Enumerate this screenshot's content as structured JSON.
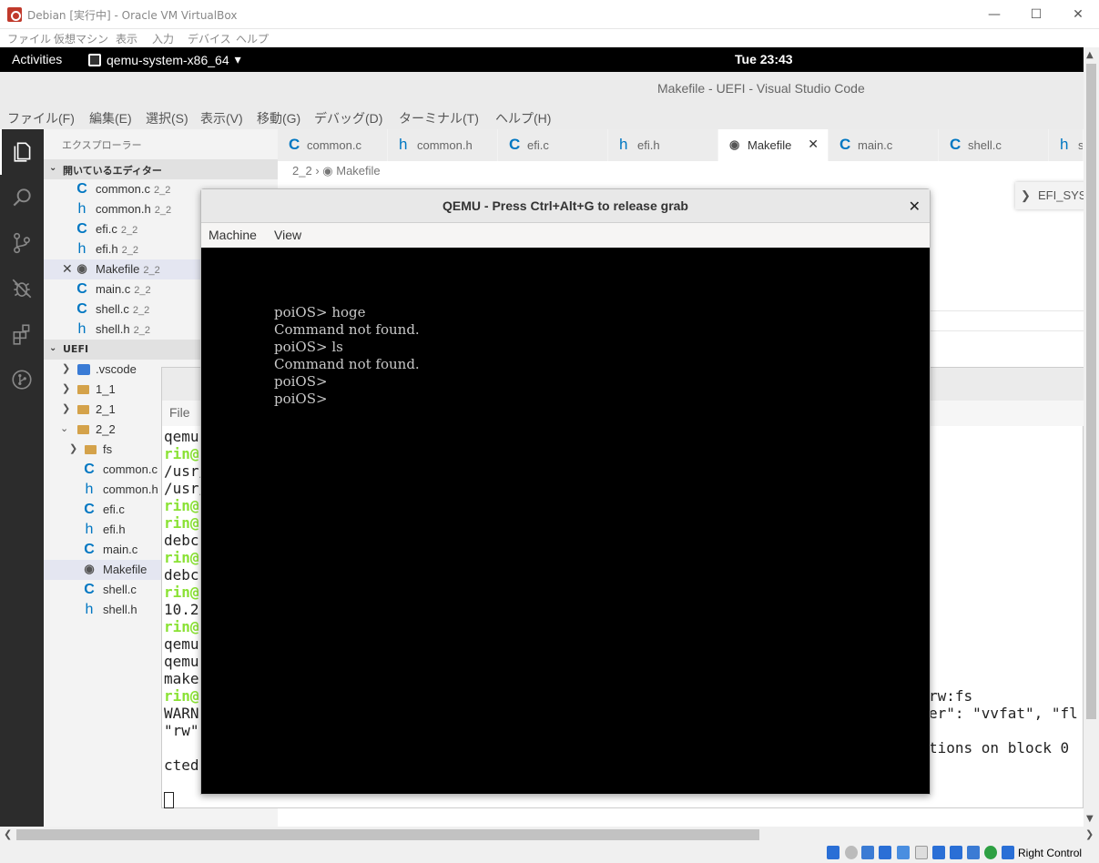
{
  "vbox": {
    "title": "Debian [実行中] - Oracle VM VirtualBox",
    "menu": [
      "ファイル",
      "仮想マシン",
      "表示",
      "入力",
      "デバイス",
      "ヘルプ"
    ],
    "host_key": "Right Control"
  },
  "gnome": {
    "activities": "Activities",
    "app": "qemu-system-x86_64",
    "clock": "Tue 23:43"
  },
  "vscode": {
    "title": "Makefile - UEFI - Visual Studio Code",
    "menu": [
      "ファイル(F)",
      "編集(E)",
      "選択(S)",
      "表示(V)",
      "移動(G)",
      "デバッグ(D)",
      "ターミナル(T)",
      "ヘルプ(H)"
    ],
    "explorer_title": "エクスプローラー",
    "open_editors_header": "開いているエディター",
    "open_editors": [
      {
        "name": "common.c",
        "tag": "2_2",
        "icon": "C"
      },
      {
        "name": "common.h",
        "tag": "2_2",
        "icon": "h"
      },
      {
        "name": "efi.c",
        "tag": "2_2",
        "icon": "C"
      },
      {
        "name": "efi.h",
        "tag": "2_2",
        "icon": "h"
      },
      {
        "name": "Makefile",
        "tag": "2_2",
        "icon": "make"
      },
      {
        "name": "main.c",
        "tag": "2_2",
        "icon": "C"
      },
      {
        "name": "shell.c",
        "tag": "2_2",
        "icon": "C"
      },
      {
        "name": "shell.h",
        "tag": "2_2",
        "icon": "h"
      }
    ],
    "workspace_header": "UEFI",
    "tree": [
      {
        "name": ".vscode",
        "kind": "folder-vscode"
      },
      {
        "name": "1_1",
        "kind": "folder"
      },
      {
        "name": "2_1",
        "kind": "folder"
      },
      {
        "name": "2_2",
        "kind": "folder-open"
      },
      {
        "name": "fs",
        "kind": "folder"
      },
      {
        "name": "common.c",
        "kind": "C"
      },
      {
        "name": "common.h",
        "kind": "h"
      },
      {
        "name": "efi.c",
        "kind": "C"
      },
      {
        "name": "efi.h",
        "kind": "h"
      },
      {
        "name": "main.c",
        "kind": "C"
      },
      {
        "name": "Makefile",
        "kind": "make"
      },
      {
        "name": "shell.c",
        "kind": "C"
      },
      {
        "name": "shell.h",
        "kind": "h"
      }
    ],
    "tabs": [
      {
        "label": "common.c",
        "icon": "C"
      },
      {
        "label": "common.h",
        "icon": "h"
      },
      {
        "label": "efi.c",
        "icon": "C"
      },
      {
        "label": "efi.h",
        "icon": "h"
      },
      {
        "label": "Makefile",
        "icon": "make"
      },
      {
        "label": "main.c",
        "icon": "C"
      },
      {
        "label": "shell.c",
        "icon": "C"
      },
      {
        "label": "sh",
        "icon": "h"
      }
    ],
    "breadcrumb_folder": "2_2",
    "breadcrumb_file": "Makefile",
    "outline_label": "EFI_SYS"
  },
  "terminal": {
    "menu_file": "File",
    "lines": [
      {
        "text": "qemu",
        "green": false
      },
      {
        "text": "rin@",
        "green": true
      },
      {
        "text": "/usr/",
        "green": false
      },
      {
        "text": "/usr/",
        "green": false
      },
      {
        "text": "rin@",
        "green": true
      },
      {
        "text": "rin@",
        "green": true
      },
      {
        "text": "debc",
        "green": false
      },
      {
        "text": "rin@",
        "green": true
      },
      {
        "text": "debc",
        "green": false
      },
      {
        "text": "rin@",
        "green": true
      },
      {
        "text": "10.2",
        "green": false
      },
      {
        "text": "rin@",
        "green": true
      },
      {
        "text": "qemu",
        "green": false
      },
      {
        "text": "qemu",
        "green": false
      },
      {
        "text": "make",
        "green": false
      },
      {
        "text": "rin@",
        "green": true
      },
      {
        "text": "WARN",
        "green": false
      },
      {
        "text": "\"rw\"",
        "green": false
      },
      {
        "text": "",
        "green": false
      },
      {
        "text": "cted",
        "green": false
      }
    ],
    "right_lines": [
      {
        "text": "rw:fs",
        "row": 15
      },
      {
        "text": "er\": \"vvfat\", \"fl",
        "row": 16
      },
      {
        "text": "tions on block 0",
        "row": 18
      }
    ]
  },
  "qemu": {
    "title": "QEMU - Press Ctrl+Alt+G to release grab",
    "menu": [
      "Machine",
      "View"
    ],
    "screen_lines": [
      "poiOS> hoge",
      "Command not found.",
      "poiOS> ls",
      "Command not found.",
      "poiOS>",
      "poiOS>"
    ]
  }
}
